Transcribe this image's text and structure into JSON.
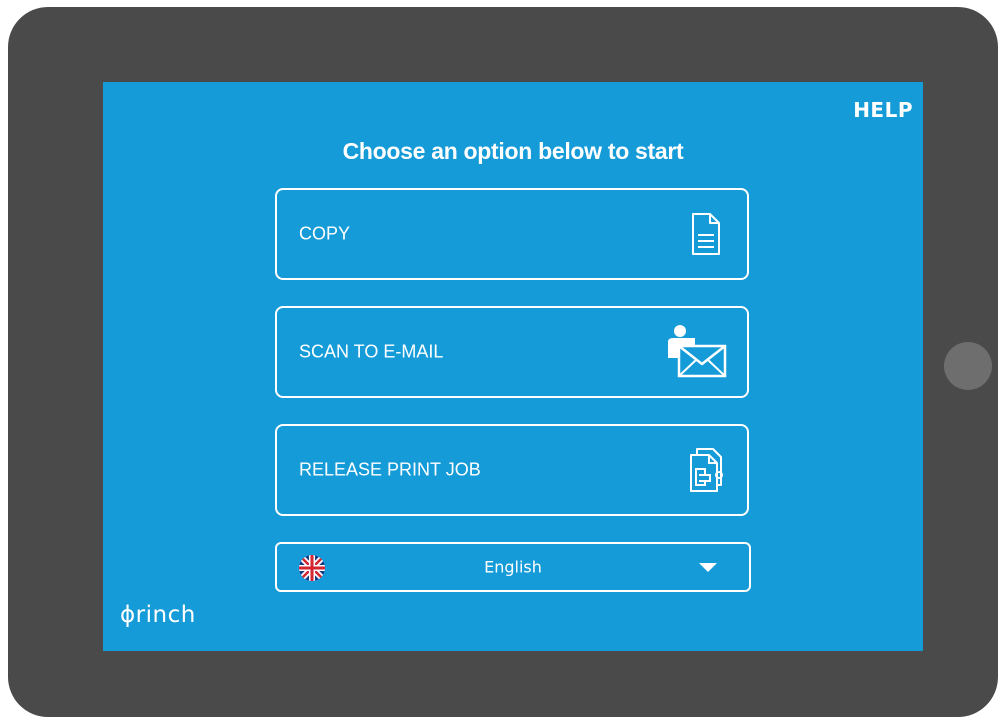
{
  "help_label": "HELP",
  "heading": "Choose an option below to start",
  "options": [
    {
      "label": "COPY",
      "icon": "document-icon"
    },
    {
      "label": "SCAN TO E-MAIL",
      "icon": "person-envelope-icon"
    },
    {
      "label": "RELEASE PRINT JOB",
      "icon": "print-release-icon"
    }
  ],
  "language": {
    "selected": "English",
    "flag": "uk-flag-icon"
  },
  "brand": "ɸrinch",
  "colors": {
    "screen_bg": "#159bd8",
    "device_frame": "#4a4a4a",
    "foreground": "#ffffff"
  }
}
